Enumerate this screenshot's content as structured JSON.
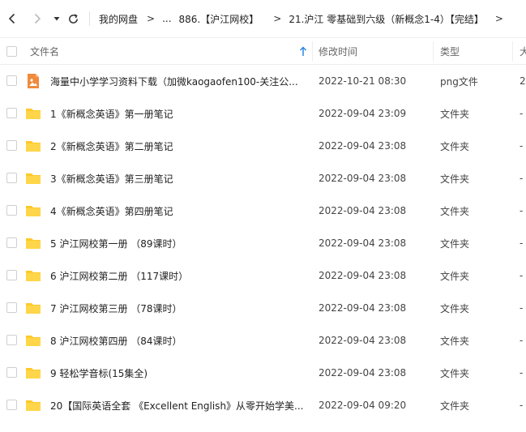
{
  "toolbar": {
    "back_icon": "chevron-left-icon",
    "forward_icon": "chevron-right-icon",
    "history_icon": "caret-down-icon",
    "refresh_icon": "refresh-icon",
    "breadcrumbs": [
      {
        "label": "我的网盘"
      },
      {
        "label": "..."
      },
      {
        "label": "886.【沪江网校】"
      },
      {
        "label": "21.沪江 零基础到六级（新概念1-4）【完结】"
      }
    ],
    "separator": ">"
  },
  "table": {
    "columns": {
      "name": "文件名",
      "modified": "修改时间",
      "type": "类型",
      "size": "大"
    },
    "sort_icon": "sort-ascending-arrow-icon",
    "rows": [
      {
        "name": "海量中小学学习资料下载（加微kaogaofen100-关注公...",
        "modified": "2022-10-21 08:30",
        "type": "png文件",
        "size": "2",
        "icon": "image-file-icon"
      },
      {
        "name": "1《新概念英语》第一册笔记",
        "modified": "2022-09-04 23:09",
        "type": "文件夹",
        "size": "-",
        "icon": "folder-icon"
      },
      {
        "name": "2《新概念英语》第二册笔记",
        "modified": "2022-09-04 23:08",
        "type": "文件夹",
        "size": "-",
        "icon": "folder-icon"
      },
      {
        "name": "3《新概念英语》第三册笔记",
        "modified": "2022-09-04 23:08",
        "type": "文件夹",
        "size": "-",
        "icon": "folder-icon"
      },
      {
        "name": "4《新概念英语》第四册笔记",
        "modified": "2022-09-04 23:08",
        "type": "文件夹",
        "size": "-",
        "icon": "folder-icon"
      },
      {
        "name": "5 沪江网校第一册 （89课时）",
        "modified": "2022-09-04 23:08",
        "type": "文件夹",
        "size": "-",
        "icon": "folder-icon"
      },
      {
        "name": "6 沪江网校第二册 （117课时）",
        "modified": "2022-09-04 23:08",
        "type": "文件夹",
        "size": "-",
        "icon": "folder-icon"
      },
      {
        "name": "7 沪江网校第三册 （78课时）",
        "modified": "2022-09-04 23:08",
        "type": "文件夹",
        "size": "-",
        "icon": "folder-icon"
      },
      {
        "name": "8 沪江网校第四册 （84课时）",
        "modified": "2022-09-04 23:08",
        "type": "文件夹",
        "size": "-",
        "icon": "folder-icon"
      },
      {
        "name": "9 轻松学音标(15集全)",
        "modified": "2022-09-04 23:08",
        "type": "文件夹",
        "size": "-",
        "icon": "folder-icon"
      },
      {
        "name": "20【国际英语全套 《Excellent English》从零开始学美...",
        "modified": "2022-09-04 09:20",
        "type": "文件夹",
        "size": "-",
        "icon": "folder-icon"
      }
    ]
  },
  "colors": {
    "folder": "#FFC92C",
    "image_file": "#F08A3C",
    "sort_arrow": "#2E86E6"
  }
}
